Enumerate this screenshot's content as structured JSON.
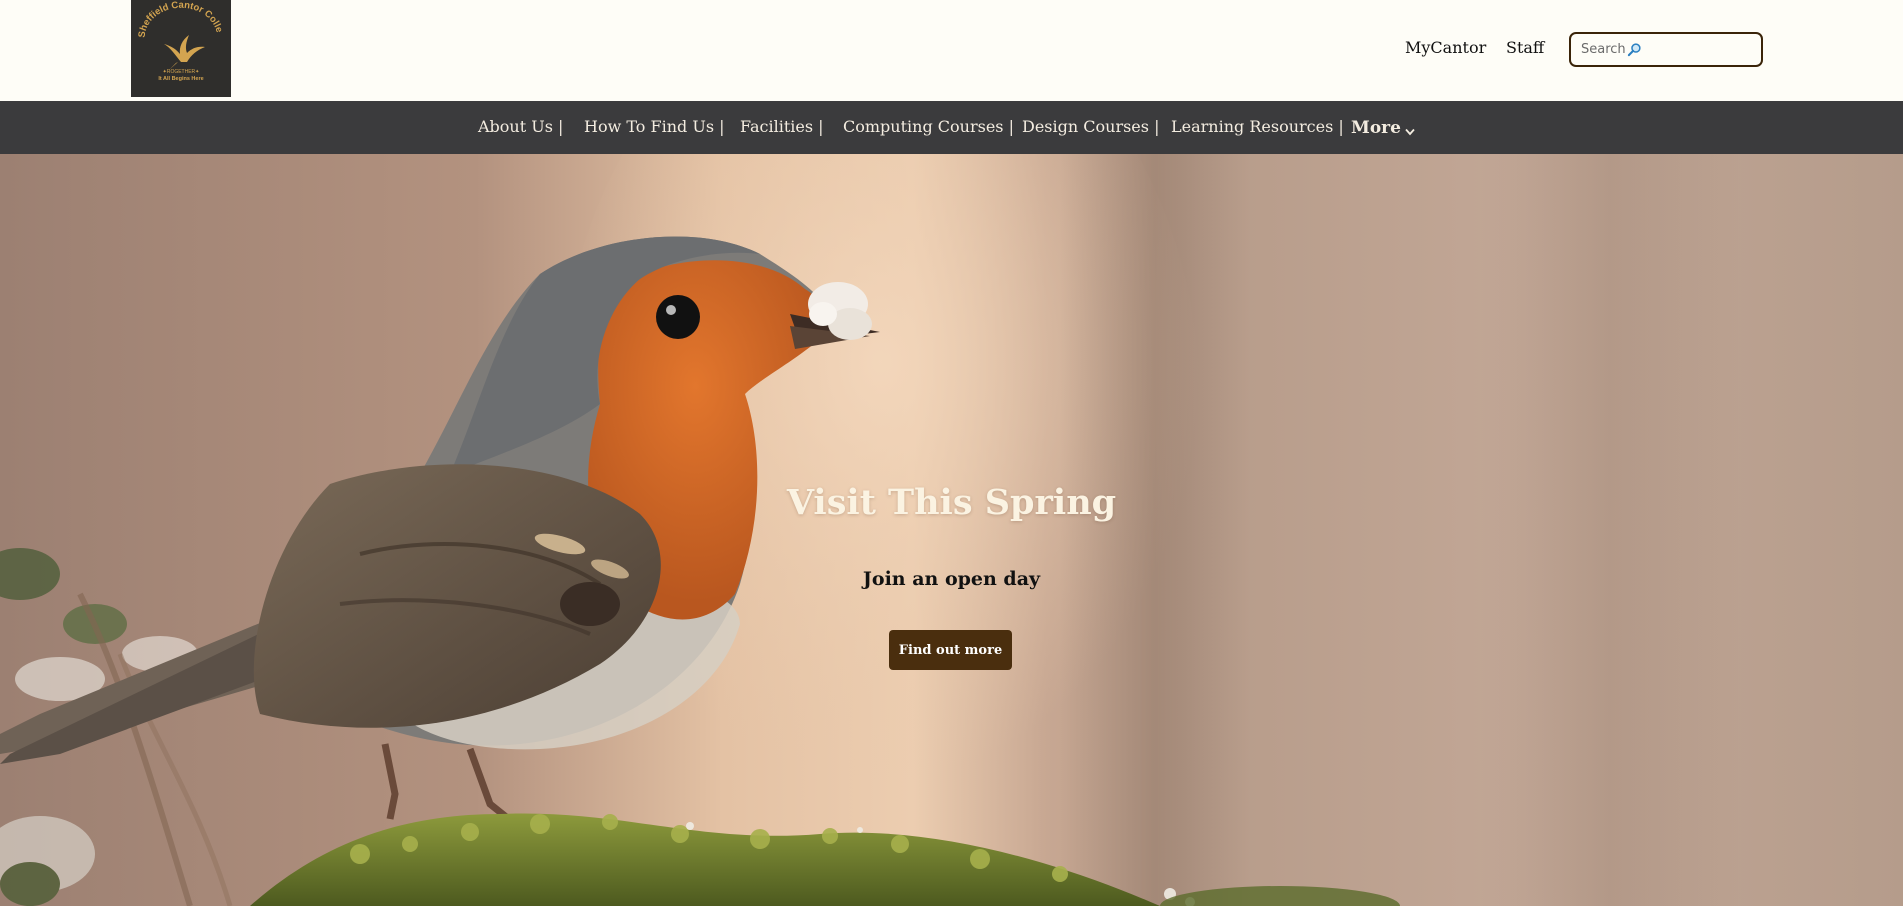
{
  "header": {
    "logo": {
      "college_name": "Sheffield Cantor College",
      "tagline_small": "✦ROGETHER✦",
      "tagline": "It All Begins Here"
    },
    "links": [
      {
        "label": "MyCantor"
      },
      {
        "label": "Staff"
      }
    ],
    "search": {
      "placeholder": "Search"
    }
  },
  "nav": {
    "items": [
      {
        "label": "About Us |"
      },
      {
        "label": "How To Find Us |"
      },
      {
        "label": "Facilities |"
      },
      {
        "label": "Computing Courses |"
      },
      {
        "label": "Design Courses |"
      },
      {
        "label": "Learning Resources |"
      }
    ],
    "more": {
      "label": "More",
      "icon": "chevron-down-icon"
    }
  },
  "hero": {
    "title": "Visit This Spring",
    "subtitle": "Join an open day",
    "cta": "Find out more",
    "image": "robin-bird-photo"
  },
  "colors": {
    "nav_background": "#3b3b3d",
    "cta_background": "#4a2e0e",
    "page_background": "#fefdf7",
    "logo_background": "#2f2e2c",
    "logo_gold": "#d3a450"
  }
}
